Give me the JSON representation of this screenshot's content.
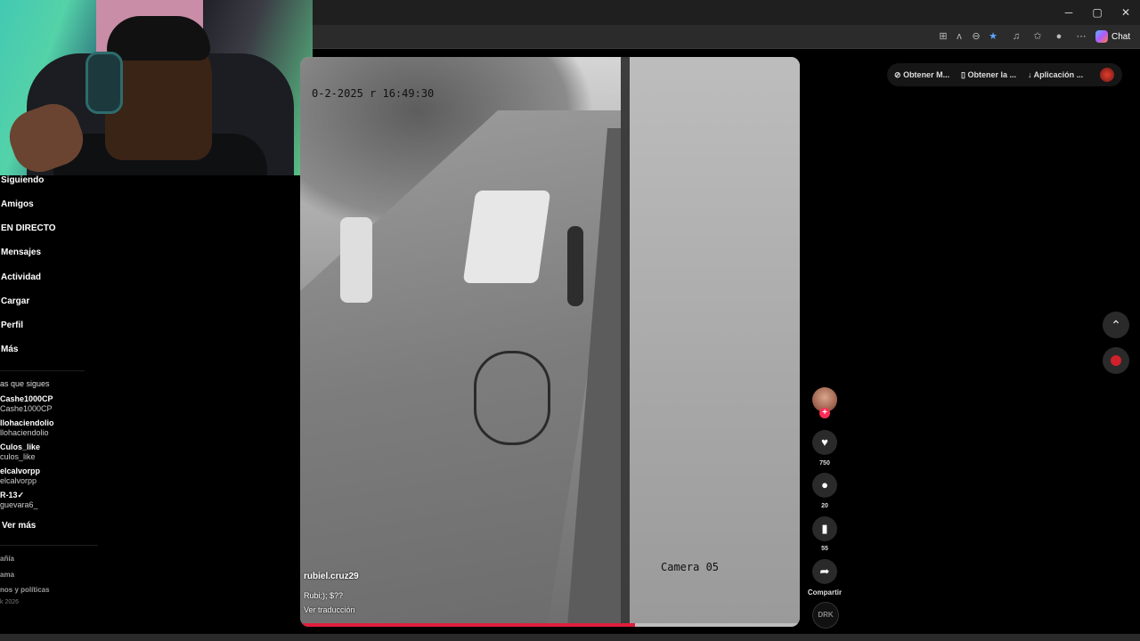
{
  "browser": {
    "window_controls": [
      "─",
      "▢",
      "✕"
    ],
    "chat_label": "Chat"
  },
  "sidebar": {
    "items": [
      {
        "label": "Siguiendo"
      },
      {
        "label": "Amigos"
      },
      {
        "label": "EN DIRECTO"
      },
      {
        "label": "Mensajes"
      },
      {
        "label": "Actividad"
      },
      {
        "label": "Cargar"
      },
      {
        "label": "Perfil"
      },
      {
        "label": "Más"
      }
    ],
    "following_title": "as que sigues",
    "accounts": [
      {
        "name": "Cashe1000CP",
        "handle": "Cashe1000CP"
      },
      {
        "name": "llohaciendolio",
        "handle": "llohaciendolio"
      },
      {
        "name": "Culos_like",
        "handle": "culos_like"
      },
      {
        "name": "elcalvorpp",
        "handle": "elcalvorpp"
      },
      {
        "name": "R-13✓",
        "handle": "guevara6_"
      }
    ],
    "see_more": "Ver más",
    "footer": [
      "añía",
      "ama",
      "nos y políticas",
      "k 2026"
    ]
  },
  "video": {
    "timestamp": "0-2-2025 r 16:49:30",
    "camera_label": "Camera 05",
    "username": "rubiel.cruz29",
    "caption": "Rubi;); $??",
    "translate": "Ver traducción",
    "progress": 0.67
  },
  "actions": {
    "likes": "750",
    "comments": "20",
    "saves": "55",
    "share": "Compartir",
    "disc": "DRK"
  },
  "top_bar": {
    "items": [
      "Obtener M...",
      "Obtener la ...",
      "Aplicación ..."
    ]
  },
  "colors": {
    "accent": "#fe2c55",
    "progress": "#e01e3c"
  }
}
